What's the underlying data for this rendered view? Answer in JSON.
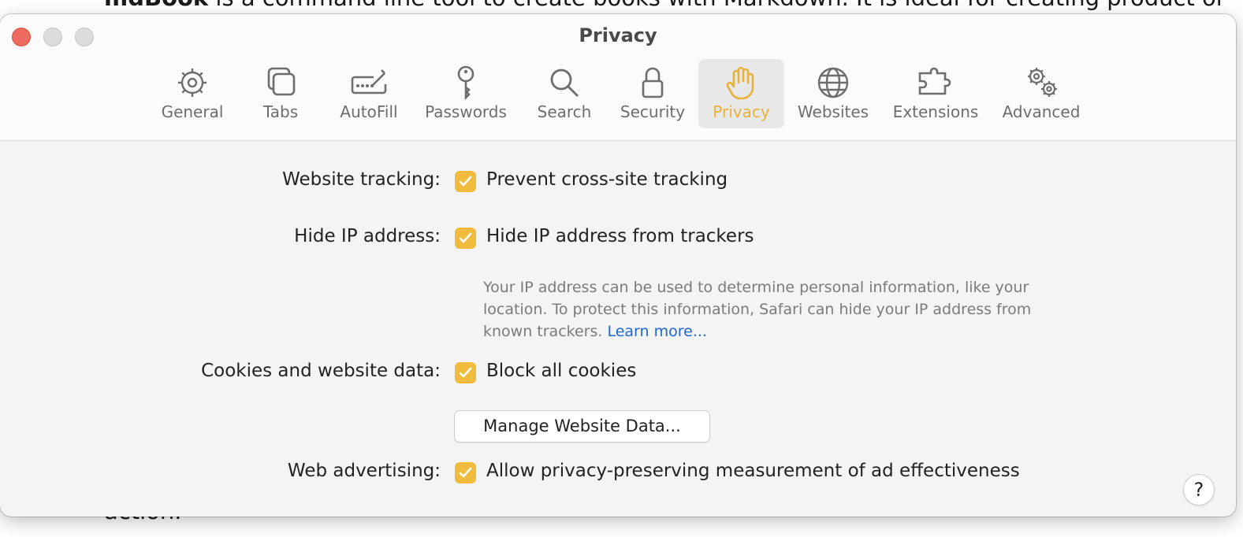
{
  "background": {
    "top_text_bold": "mdBook",
    "top_text": " is a command line tool to create books with Markdown. It is ideal for creating product or",
    "bottom_text": "action."
  },
  "window": {
    "title": "Privacy"
  },
  "tabs": [
    {
      "label": "General",
      "icon": "gear-icon"
    },
    {
      "label": "Tabs",
      "icon": "tabs-icon"
    },
    {
      "label": "AutoFill",
      "icon": "autofill-icon"
    },
    {
      "label": "Passwords",
      "icon": "key-icon"
    },
    {
      "label": "Search",
      "icon": "search-icon"
    },
    {
      "label": "Security",
      "icon": "lock-icon"
    },
    {
      "label": "Privacy",
      "icon": "hand-icon",
      "active": true
    },
    {
      "label": "Websites",
      "icon": "globe-icon"
    },
    {
      "label": "Extensions",
      "icon": "puzzle-icon"
    },
    {
      "label": "Advanced",
      "icon": "gears-icon"
    }
  ],
  "settings": {
    "tracking": {
      "label": "Website tracking:",
      "option": "Prevent cross-site tracking",
      "checked": true
    },
    "hide_ip": {
      "label": "Hide IP address:",
      "option": "Hide IP address from trackers",
      "checked": true,
      "description": "Your IP address can be used to determine personal information, like your location. To protect this information, Safari can hide your IP address from known trackers.",
      "link": "Learn more..."
    },
    "cookies": {
      "label": "Cookies and website data:",
      "option": "Block all cookies",
      "checked": true,
      "button": "Manage Website Data..."
    },
    "advertising": {
      "label": "Web advertising:",
      "option": "Allow privacy-preserving measurement of ad effectiveness",
      "checked": true
    }
  },
  "help_button": "?",
  "colors": {
    "accent": "#f1bc3e",
    "link": "#2067d6",
    "close": "#ed6a5e"
  }
}
